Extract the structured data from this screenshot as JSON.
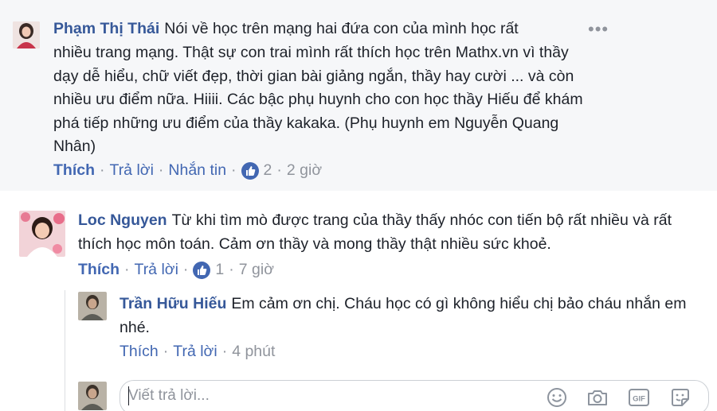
{
  "comments": [
    {
      "author": "Phạm Thị Thái",
      "text_line1": "Nói về học trên mạng hai đứa con của mình học rất",
      "text_rest": "nhiều trang mạng. Thật sự con trai mình rất thích học trên Mathx.vn vì thầy dạy dễ hiểu, chữ viết đẹp, thời gian bài giảng ngắn, thầy hay cười ... và còn nhiều ưu điểm nữa. Hiiii. Các bậc phụ huynh cho con học thầy Hiếu để khám phá tiếp những ưu điểm của thầy kakaka. (Phụ huynh em Nguyễn Quang Nhân)",
      "like_label": "Thích",
      "reply_label": "Trả lời",
      "message_label": "Nhắn tin",
      "likes": "2",
      "time": "2 giờ"
    },
    {
      "author": "Loc Nguyen",
      "text": "Từ khi tìm mò được trang của thầy thấy nhóc con tiến bộ rất nhiều và rất thích học môn toán. Cảm ơn thầy và mong thầy thật nhiều sức khoẻ.",
      "like_label": "Thích",
      "reply_label": "Trả lời",
      "likes": "1",
      "time": "7 giờ"
    },
    {
      "author": "Trần Hữu Hiếu",
      "text": "Em cảm ơn chị. Cháu học có gì không hiểu chị bảo cháu nhắn em nhé.",
      "like_label": "Thích",
      "reply_label": "Trả lời",
      "time": "4 phút"
    }
  ],
  "more_options": "•••",
  "reply_box": {
    "placeholder": "Viết trả lời..."
  },
  "separator": "·",
  "colors": {
    "link": "#4267b2",
    "author": "#365899",
    "meta": "#90949c",
    "top_panel_bg": "#f6f7f9"
  },
  "icons": [
    "like-thumb-icon",
    "emoji-icon",
    "camera-icon",
    "gif-icon",
    "sticker-icon",
    "more-options-icon"
  ]
}
